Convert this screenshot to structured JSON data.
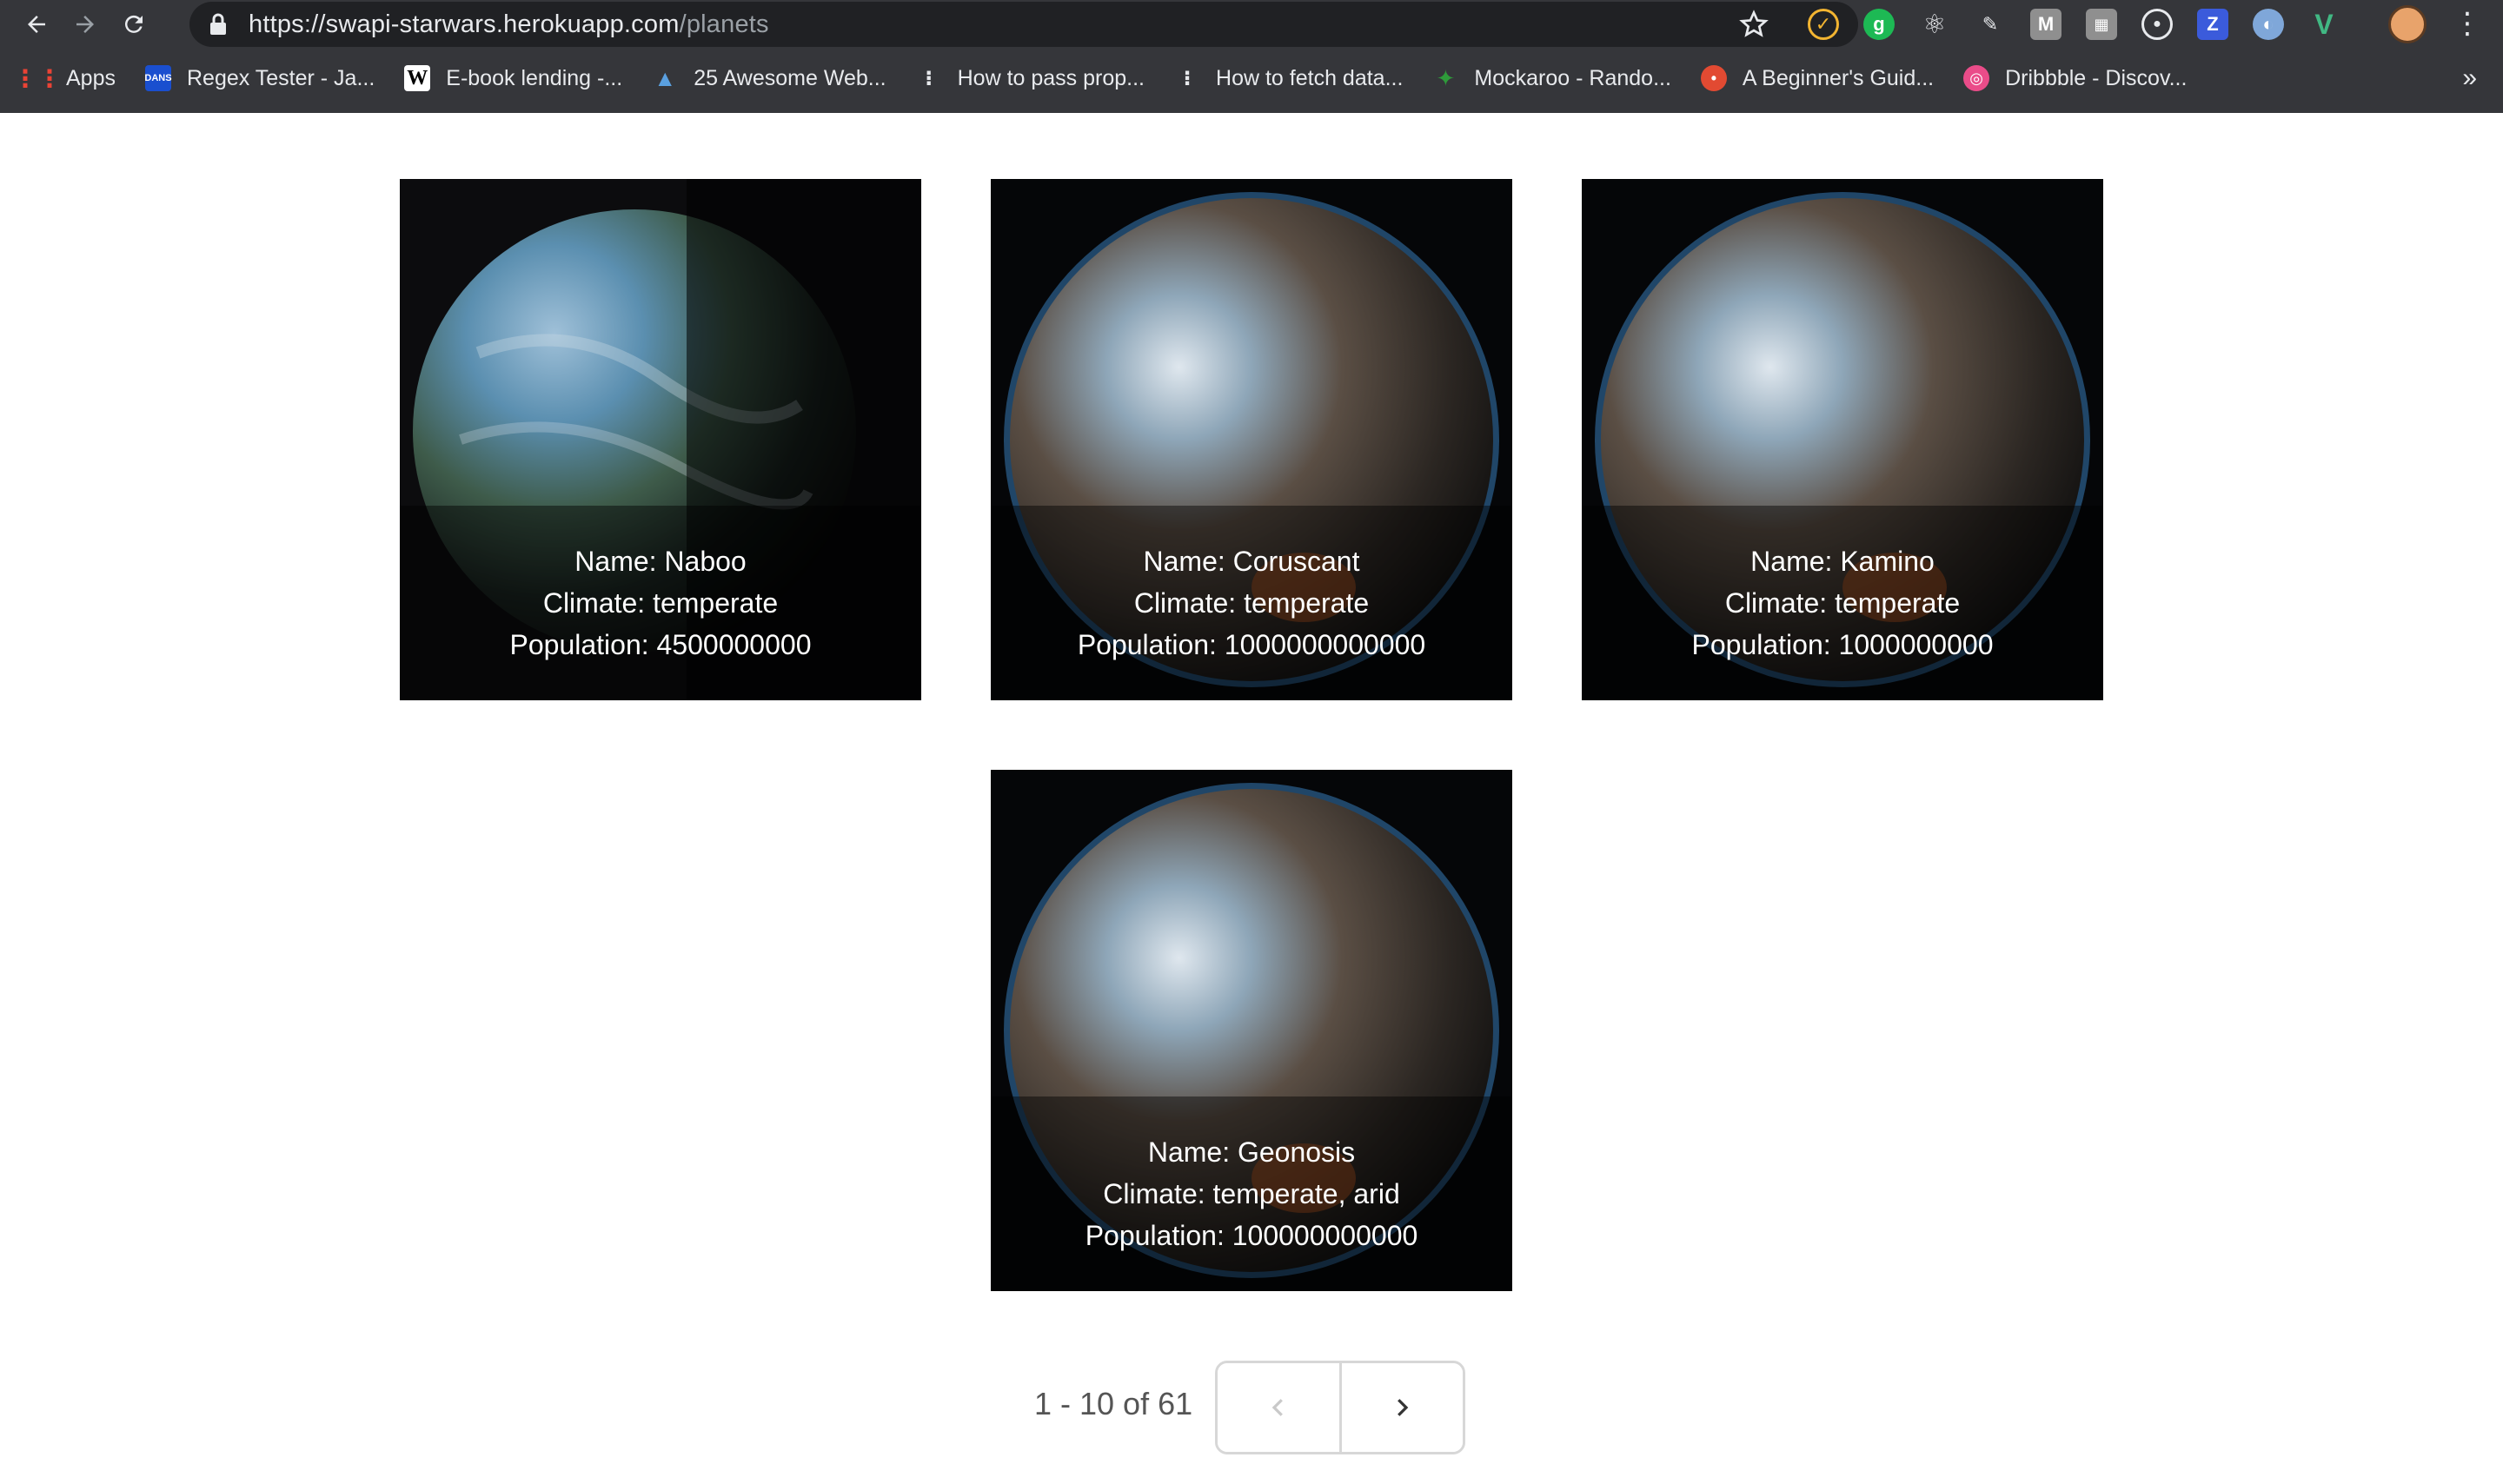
{
  "browser": {
    "url_host": "https://swapi-starwars.herokuapp.com",
    "url_path": "/planets",
    "bookmarks": [
      {
        "label": "Apps",
        "icon": "apps-grid-icon"
      },
      {
        "label": "Regex Tester - Ja...",
        "icon": "dans-tools-icon"
      },
      {
        "label": "E-book lending -...",
        "icon": "wikipedia-icon"
      },
      {
        "label": "25 Awesome Web...",
        "icon": "triangle-logo-icon"
      },
      {
        "label": "How to pass prop...",
        "icon": "dots-icon"
      },
      {
        "label": "How to fetch data...",
        "icon": "dots-icon"
      },
      {
        "label": "Mockaroo - Rando...",
        "icon": "mockaroo-icon"
      },
      {
        "label": "A Beginner's Guid...",
        "icon": "tomato-icon"
      },
      {
        "label": "Dribbble - Discov...",
        "icon": "dribbble-icon"
      }
    ],
    "more_label": "»"
  },
  "planets": [
    {
      "name": "Name: Naboo",
      "climate": "Climate: temperate",
      "population": "Population: 4500000000"
    },
    {
      "name": "Name: Coruscant",
      "climate": "Climate: temperate",
      "population": "Population: 1000000000000"
    },
    {
      "name": "Name: Kamino",
      "climate": "Climate: temperate",
      "population": "Population: 1000000000"
    },
    {
      "name": "Name: Geonosis",
      "climate": "Climate: temperate, arid",
      "population": "Population: 100000000000"
    }
  ],
  "pagination": {
    "range_text": "1 - 10 of 61"
  }
}
